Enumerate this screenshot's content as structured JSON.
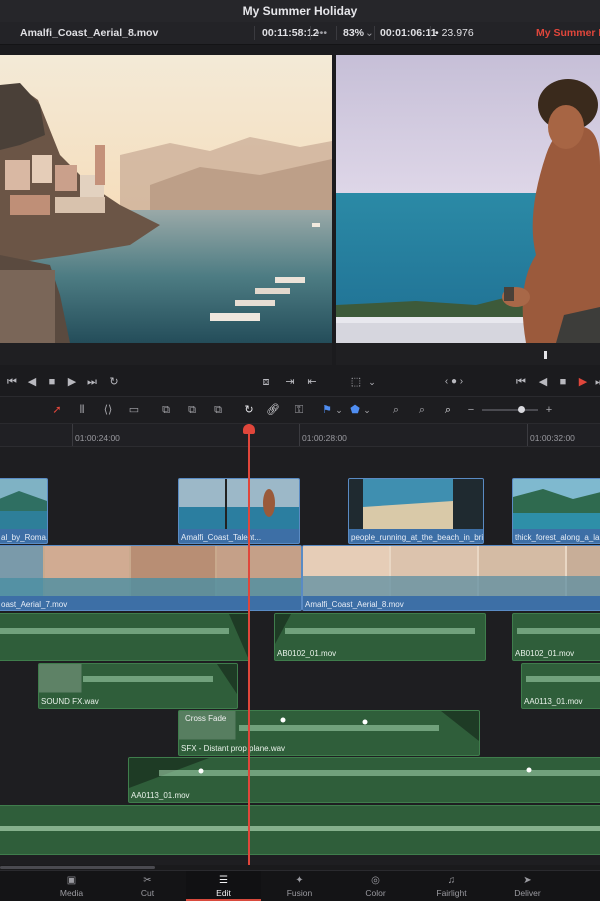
{
  "app": {
    "title": "My Summer Holiday"
  },
  "viewer_header": {
    "source_clip": "Amalfi_Coast_Aerial_8.mov",
    "source_timecode": "00:11:58:12",
    "more": "•••",
    "zoom": "83%",
    "timeline_timecode": "00:01:06:11",
    "fps": "• 23.976",
    "timeline_name": "My Summer Holid"
  },
  "transport": {
    "prev": "⏮",
    "back": "◀",
    "stop": "■",
    "play": "▶",
    "next": "⏭",
    "loop": "↻"
  },
  "ruler": {
    "marks": [
      "01:00:24:00",
      "01:00:28:00",
      "01:00:32:00"
    ]
  },
  "timeline": {
    "video_clips_v2": [
      {
        "label": "al_by_Roma..."
      },
      {
        "label": "Amalfi_Coast_Talent..."
      },
      {
        "label": "people_running_at_the_beach_in_brig..."
      },
      {
        "label": "thick_forest_along_a_lake_..."
      }
    ],
    "video_clips_v1": [
      {
        "label": "oast_Aerial_7.mov"
      },
      {
        "label": "Amalfi_Coast_Aerial_8.mov"
      }
    ],
    "audio": {
      "a1": [
        "AB0102_01.mov",
        "AB0102_01.mov"
      ],
      "a2": [
        "SOUND FX.wav",
        "AA0113_01.mov"
      ],
      "a3_label": "SFX - Distant prop plane.wav",
      "cross_fade": "Cross Fade",
      "a4_label": "AA0113_01.mov"
    }
  },
  "pages": [
    {
      "label": "Media",
      "icon": "▣"
    },
    {
      "label": "Cut",
      "icon": "✂"
    },
    {
      "label": "Edit",
      "icon": "☰"
    },
    {
      "label": "Fusion",
      "icon": "✦"
    },
    {
      "label": "Color",
      "icon": "◎"
    },
    {
      "label": "Fairlight",
      "icon": "♫"
    },
    {
      "label": "Deliver",
      "icon": "➤"
    }
  ],
  "colors": {
    "accent": "#d94a3d",
    "playhead": "#e0463b",
    "video_clip": "#3d6fa6",
    "audio_clip": "#2f5e3a"
  }
}
